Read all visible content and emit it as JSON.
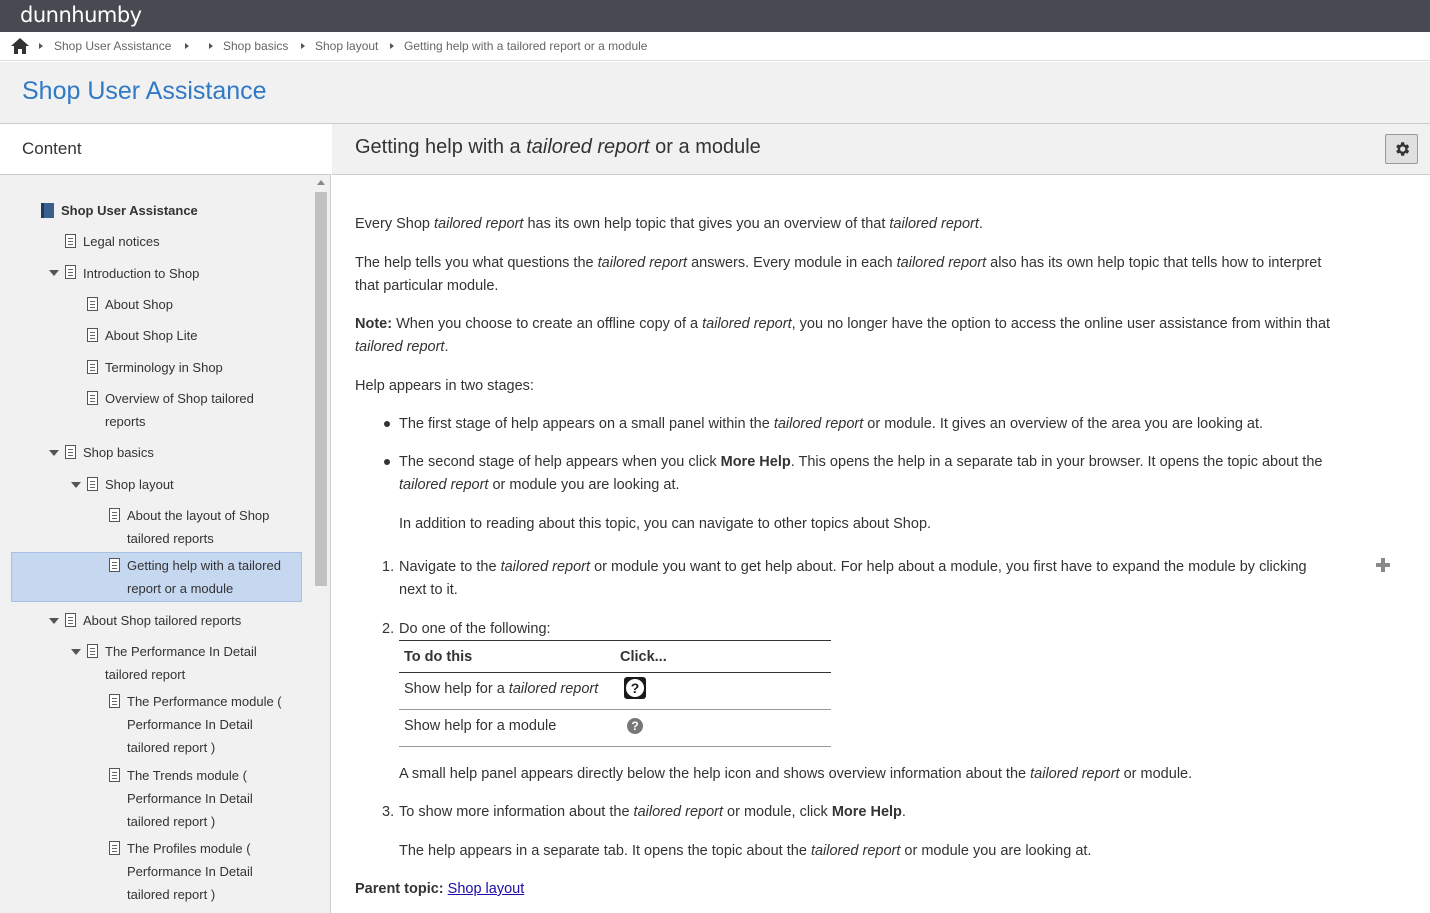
{
  "brand": "dunnhumby",
  "breadcrumb": [
    "Shop User Assistance",
    "Shop basics",
    "Shop layout",
    "Getting help with a tailored report or a module"
  ],
  "site_title": "Shop User Assistance",
  "sidebar": {
    "heading": "Content",
    "items": [
      {
        "label": "Shop User Assistance"
      },
      {
        "label": "Legal notices"
      },
      {
        "label": "Introduction to Shop"
      },
      {
        "label": "About Shop"
      },
      {
        "label": "About Shop Lite"
      },
      {
        "label": "Terminology in Shop"
      },
      {
        "label": "Overview of Shop tailored",
        "label2": "reports"
      },
      {
        "label": "Shop basics"
      },
      {
        "label": "Shop layout"
      },
      {
        "label": "About the layout of Shop",
        "label2": "tailored reports"
      },
      {
        "label": "Getting help with a tailored",
        "label2": "report or a module"
      },
      {
        "label": "About Shop tailored reports"
      },
      {
        "label": "The Performance In Detail",
        "label2": "tailored report"
      },
      {
        "label": "The Performance module (",
        "label2": "Performance In Detail",
        "label3": "tailored report )"
      },
      {
        "label": "The Trends module (",
        "label2": "Performance In Detail",
        "label3": "tailored report )"
      },
      {
        "label": "The Profiles module (",
        "label2": "Performance In Detail",
        "label3": "tailored report )"
      }
    ]
  },
  "topic": {
    "title_pre": "Getting help with a ",
    "title_em": "tailored report",
    "title_post": " or a module"
  },
  "content": {
    "p1": [
      "Every Shop ",
      "tailored report",
      " has its own help topic that gives you an overview of that ",
      "tailored report",
      "."
    ],
    "p2a": [
      "The help tells you what questions the ",
      "tailored report",
      " answers. Every module in each ",
      "tailored report",
      " also has its own help topic that tells how to interpret"
    ],
    "p2b": "that particular module.",
    "note_label": "Note:",
    "note_a": [
      " When you choose to create an offline copy of a ",
      "tailored report",
      ", you no longer have the option to access the online user assistance from within that"
    ],
    "note_b": [
      "tailored report",
      "."
    ],
    "p3": "Help appears in two stages:",
    "b1": [
      "The first stage of help appears on a small panel within the ",
      "tailored report",
      " or module. It gives an overview of the area you are looking at."
    ],
    "b2a": [
      "The second stage of help appears when you click ",
      "More Help",
      ". This opens the help in a separate tab in your browser. It opens the topic about the"
    ],
    "b2b": [
      "tailored report",
      " or module you are looking at."
    ],
    "b2c": "In addition to reading about this topic, you can navigate to other topics about Shop.",
    "s1_num": "1.",
    "s1a": [
      "Navigate to the ",
      "tailored report",
      " or module you want to get help about. For help about a module, you first have to expand the module by clicking"
    ],
    "s1b": "next to it.",
    "s2_num": "2.",
    "s2": "Do one of the following:",
    "table": {
      "headers": [
        "To do this",
        "Click..."
      ],
      "rows": [
        {
          "pre": "Show help for a ",
          "em": "tailored report"
        },
        {
          "pre": "Show help for a module",
          "em": ""
        }
      ]
    },
    "s2_after": [
      "A small help panel appears directly below the help icon and shows overview information about the ",
      "tailored report",
      " or module."
    ],
    "s3_num": "3.",
    "s3": [
      "To show more information about the ",
      "tailored report",
      " or module, click ",
      "More Help",
      "."
    ],
    "s3_after": [
      "The help appears in a separate tab. It opens the topic about the ",
      "tailored report",
      " or module you are looking at."
    ],
    "parent_label": "Parent topic:",
    "parent_link": "Shop layout"
  }
}
